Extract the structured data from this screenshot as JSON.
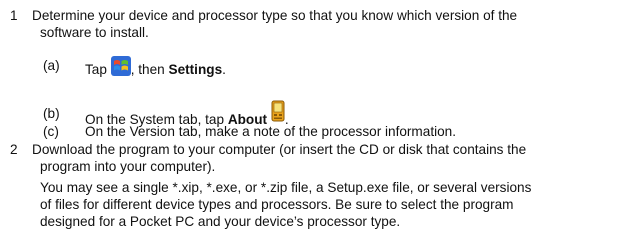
{
  "steps": [
    {
      "number": "1",
      "lines": [
        "Determine your device and processor type so that you know which version of the",
        "software to install."
      ],
      "substeps": [
        {
          "label": "(a)",
          "pre": "Tap ",
          "icon": "windows-start-icon",
          "mid": ", then ",
          "bold": "Settings",
          "post": "."
        },
        {
          "label": "(b)",
          "pre": "On the System tab, tap ",
          "bold": "About",
          "icon": "about-device-icon",
          "post": "."
        },
        {
          "label": "(c)",
          "text": "On the Version tab, make a note of the processor information."
        }
      ]
    },
    {
      "number": "2",
      "lines": [
        "Download the program to your computer (or insert the CD or disk that contains the",
        "program into your computer)."
      ],
      "note_lines": [
        "You may see a single *.xip, *.exe, or *.zip file, a Setup.exe file, or several versions",
        "of files for different device types and processors. Be sure to select the program",
        "designed for a Pocket PC and your device’s processor type."
      ]
    }
  ]
}
